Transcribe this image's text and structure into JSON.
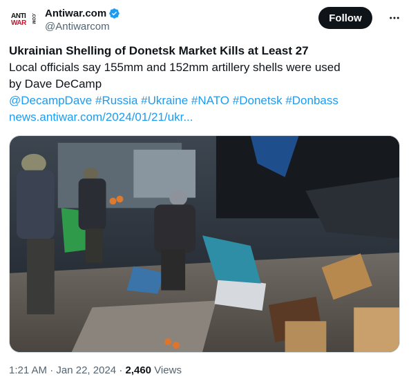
{
  "account": {
    "display_name": "Antiwar.com",
    "handle": "@Antiwarcom",
    "avatar_text_top": "ANTI",
    "avatar_text_bottom": "WAR",
    "avatar_text_side": ".COM",
    "verified_color": "#1d9bf0"
  },
  "actions": {
    "follow_label": "Follow",
    "more_icon": "more-horizontal-icon"
  },
  "post": {
    "headline": "Ukrainian Shelling of Donetsk Market Kills at Least 27",
    "subtitle": "Local officials say 155mm and 152mm artillery shells were used",
    "byline": "by Dave DeCamp",
    "tags": [
      "@DecampDave",
      "#Russia",
      "#Ukraine",
      "#NATO",
      "#Donetsk",
      "#Donbass"
    ],
    "link_text": "news.antiwar.com/2024/01/21/ukr...",
    "link_color": "#1d9bf0"
  },
  "meta": {
    "time": "1:21 AM",
    "separator1": "·",
    "date": "Jan 22, 2024",
    "separator2": "·",
    "views_count": "2,460",
    "views_label": "Views"
  }
}
